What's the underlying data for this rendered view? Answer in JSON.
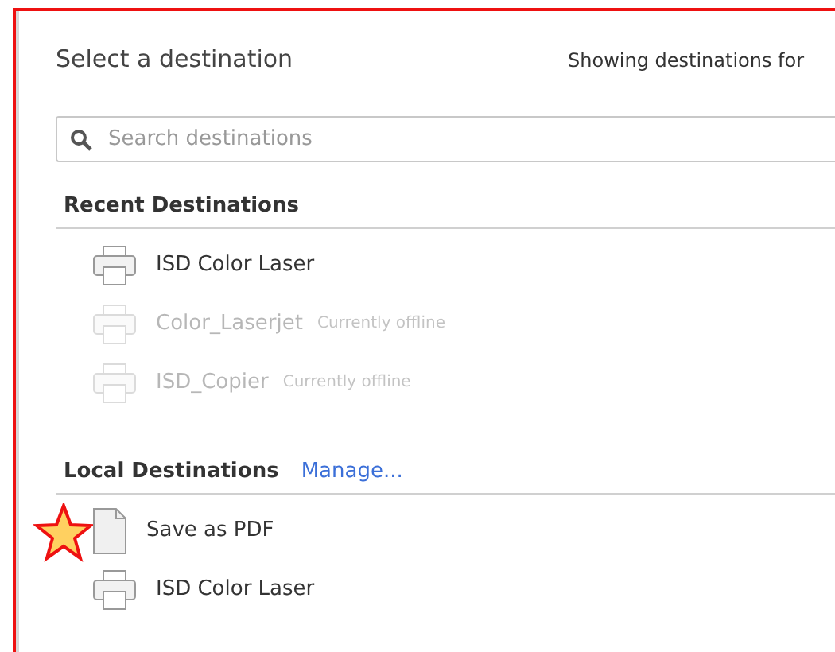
{
  "dialog": {
    "title": "Select a destination",
    "subtitle": "Showing destinations for"
  },
  "search": {
    "placeholder": "Search destinations"
  },
  "sections": [
    {
      "heading": "Recent Destinations",
      "items": [
        {
          "kind": "printer",
          "name": "ISD Color Laser",
          "offline": false
        },
        {
          "kind": "printer",
          "name": "Color_Laserjet",
          "offline": true,
          "status": "Currently offline"
        },
        {
          "kind": "printer",
          "name": "ISD_Copier",
          "offline": true,
          "status": "Currently offline"
        }
      ]
    },
    {
      "heading": "Local Destinations",
      "link": "Manage...",
      "items": [
        {
          "kind": "document",
          "name": "Save as PDF",
          "offline": false,
          "starred": true
        },
        {
          "kind": "printer",
          "name": "ISD Color Laser",
          "offline": false
        }
      ]
    }
  ]
}
